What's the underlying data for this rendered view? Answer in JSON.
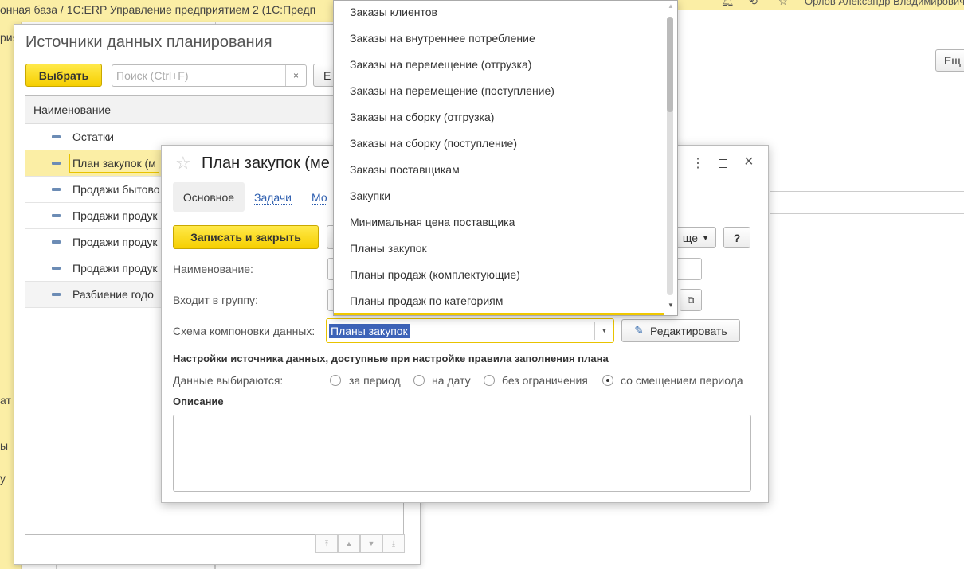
{
  "app": {
    "title": "онная база / 1С:ERP Управление предприятием 2  (1С:Предп",
    "user": "Орлов Александр Владимирович"
  },
  "sidebar": {
    "fragments": [
      "рия",
      "ат",
      "ы",
      "у"
    ]
  },
  "background": {
    "more_button": "Ещ"
  },
  "sources_window": {
    "title": "Источники данных планирования",
    "select_button": "Выбрать",
    "search_placeholder": "Поиск (Ctrl+F)",
    "clear_icon": "×",
    "partial_button": "Е",
    "column_header": "Наименование",
    "rows": [
      "Остатки",
      "План закупок (м",
      "Продажи бытово",
      "Продажи продук",
      "Продажи продук",
      "Продажи продук",
      "Разбиение годо"
    ]
  },
  "plan_window": {
    "title": "План закупок (ме",
    "tabs": [
      "Основное",
      "Задачи",
      "Мо"
    ],
    "save_close_button": "Записать и закрыть",
    "more_button": "ще",
    "help_button": "?",
    "name_label": "Наименование:",
    "group_label": "Входит в группу:",
    "schema_label": "Схема компоновки данных:",
    "schema_value": "Планы закупок",
    "edit_button": "Редактировать",
    "settings_heading": "Настройки источника данных, доступные при настройке правила заполнения плана",
    "data_label": "Данные выбираются:",
    "radio_options": [
      "за период",
      "на дату",
      "без ограничения",
      "со смещением периода"
    ],
    "radio_selected": 3,
    "description_label": "Описание"
  },
  "dropdown": {
    "items": [
      "Заказы клиентов",
      "Заказы на внутреннее потребление",
      "Заказы на перемещение (отгрузка)",
      "Заказы на перемещение (поступление)",
      "Заказы на сборку (отгрузка)",
      "Заказы на сборку (поступление)",
      "Заказы поставщикам",
      "Закупки",
      "Минимальная цена поставщика",
      "Планы закупок",
      "Планы продаж (комплектующие)",
      "Планы продаж по категориям"
    ]
  }
}
